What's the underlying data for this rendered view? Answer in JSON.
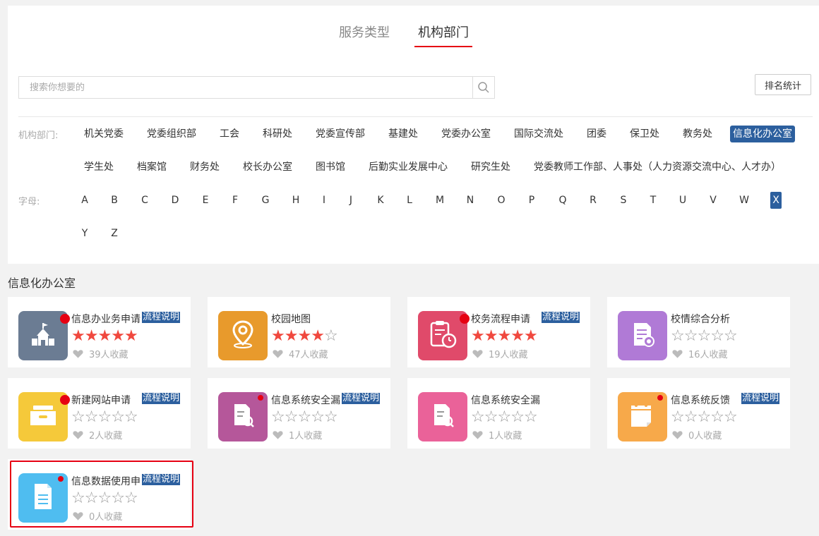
{
  "tabs": [
    {
      "label": "服务类型"
    },
    {
      "label": "机构部门"
    }
  ],
  "search": {
    "placeholder": "搜索你想要的",
    "value": ""
  },
  "rank_button": "排名统计",
  "dept_label": "机构部门:",
  "letter_label": "字母:",
  "departments": [
    "机关党委",
    "党委组织部",
    "工会",
    "科研处",
    "党委宣传部",
    "基建处",
    "党委办公室",
    "国际交流处",
    "团委",
    "保卫处",
    "教务处",
    "信息化办公室",
    "学生处",
    "档案馆",
    "财务处",
    "校长办公室",
    "图书馆",
    "后勤实业发展中心",
    "研究生处",
    "党委教师工作部、人事处（人力资源交流中心、人才办）"
  ],
  "active_department": "信息化办公室",
  "letters": [
    "A",
    "B",
    "C",
    "D",
    "E",
    "F",
    "G",
    "H",
    "I",
    "J",
    "K",
    "L",
    "M",
    "N",
    "O",
    "P",
    "Q",
    "R",
    "S",
    "T",
    "U",
    "V",
    "W",
    "X",
    "Y",
    "Z"
  ],
  "active_letter": "X",
  "section_title": "信息化办公室",
  "flow_label": "流程说明",
  "cards": [
    {
      "title": "信息办业务申请",
      "rating": 5,
      "favorites": "39人收藏",
      "has_flow": true,
      "icon": "school-building-icon",
      "color": "#6b7c93"
    },
    {
      "title": "校园地图",
      "rating": 4,
      "favorites": "47人收藏",
      "has_flow": false,
      "icon": "map-pin-icon",
      "color": "#e89a2c"
    },
    {
      "title": "校务流程申请",
      "rating": 5,
      "favorites": "19人收藏",
      "has_flow": true,
      "icon": "clipboard-timer-icon",
      "color": "#e04a6a"
    },
    {
      "title": "校情综合分析",
      "rating": 0,
      "favorites": "16人收藏",
      "has_flow": false,
      "icon": "document-badge-icon",
      "color": "#b07ad6"
    },
    {
      "title": "新建网站申请",
      "rating": 0,
      "favorites": "2人收藏",
      "has_flow": true,
      "icon": "drawer-box-icon",
      "color": "#f5c93a"
    },
    {
      "title": "信息系统安全漏",
      "rating": 0,
      "favorites": "1人收藏",
      "has_flow": true,
      "icon": "file-search-icon",
      "color": "#b5579a"
    },
    {
      "title": "信息系统安全漏",
      "rating": 0,
      "favorites": "1人收藏",
      "has_flow": false,
      "icon": "file-search-icon",
      "color": "#ea6299"
    },
    {
      "title": "信息系统反馈",
      "rating": 0,
      "favorites": "0人收藏",
      "has_flow": true,
      "icon": "calendar-page-icon",
      "color": "#f7a94a"
    },
    {
      "title": "信息数据使用申",
      "rating": 0,
      "favorites": "0人收藏",
      "has_flow": true,
      "icon": "document-lines-icon",
      "color": "#4fbdf0"
    }
  ],
  "colors": {
    "accent": "#2c5f9e",
    "tab_underline": "#e60012",
    "star_on": "#f0483e"
  }
}
